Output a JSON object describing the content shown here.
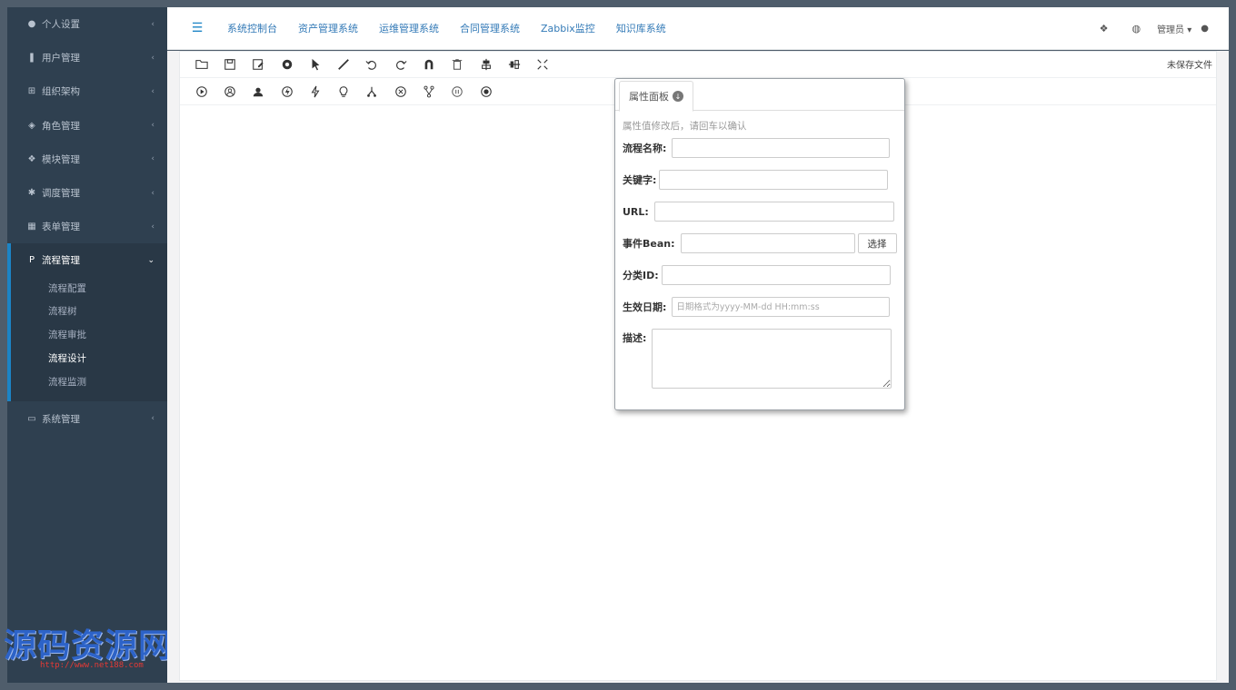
{
  "sidebar": {
    "items_top": [
      {
        "label": "个人设置",
        "icon": "user-icon"
      },
      {
        "label": "用户管理",
        "icon": "users-icon"
      },
      {
        "label": "组织架构",
        "icon": "sitemap-icon"
      },
      {
        "label": "角色管理",
        "icon": "eye-slash-icon"
      },
      {
        "label": "模块管理",
        "icon": "cube-icon"
      },
      {
        "label": "调度管理",
        "icon": "cog-icon"
      },
      {
        "label": "表单管理",
        "icon": "grid-icon"
      }
    ],
    "active_group": {
      "label": "流程管理",
      "icon": "paragraph-icon",
      "children": [
        "流程配置",
        "流程树",
        "流程审批",
        "流程设计",
        "流程监测"
      ]
    },
    "items_bottom": [
      {
        "label": "系统管理",
        "icon": "laptop-icon"
      }
    ],
    "collapsed_chevron": "‹",
    "expanded_chevron": "⌄"
  },
  "watermark": {
    "text": "源码资源网",
    "url": "http://www.net188.com"
  },
  "topnav": {
    "links": [
      "系统控制台",
      "资产管理系统",
      "运维管理系统",
      "合同管理系统",
      "Zabbix监控",
      "知识库系统"
    ],
    "user_label": "管理员 ▾"
  },
  "designer": {
    "status": "未保存文件",
    "toolbar_row1": [
      "open-icon",
      "save-icon",
      "save-as-icon",
      "settings-icon",
      "select-pointer-icon",
      "line-tool-icon",
      "undo-icon",
      "redo-icon",
      "magnet-icon",
      "delete-icon",
      "align-center-icon",
      "align-middle-icon",
      "compress-icon"
    ],
    "toolbar_row2": [
      "start-node-icon",
      "user-task-icon",
      "group-task-icon",
      "event-node-icon",
      "script-node-icon",
      "decision-node-icon",
      "fork-node-icon",
      "join-node-icon",
      "subprocess-node-icon",
      "pause-node-icon",
      "end-node-icon"
    ]
  },
  "property_panel": {
    "tab_label": "属性面板",
    "hint": "属性值修改后，请回车以确认",
    "fields": {
      "name_label": "流程名称:",
      "name_value": "",
      "keyword_label": "关键字:",
      "keyword_value": "",
      "url_label": "URL:",
      "url_value": "",
      "bean_label": "事件Bean:",
      "bean_value": "",
      "bean_button": "选择",
      "category_label": "分类ID:",
      "category_value": "",
      "date_label": "生效日期:",
      "date_placeholder": "日期格式为yyyy-MM-dd HH:mm:ss",
      "desc_label": "描述:",
      "desc_value": ""
    }
  },
  "colors": {
    "sidebar_bg": "#2f4050",
    "active_accent": "#1c84c6",
    "link": "#337ab7",
    "frame_bg": "#4f5d6b"
  }
}
